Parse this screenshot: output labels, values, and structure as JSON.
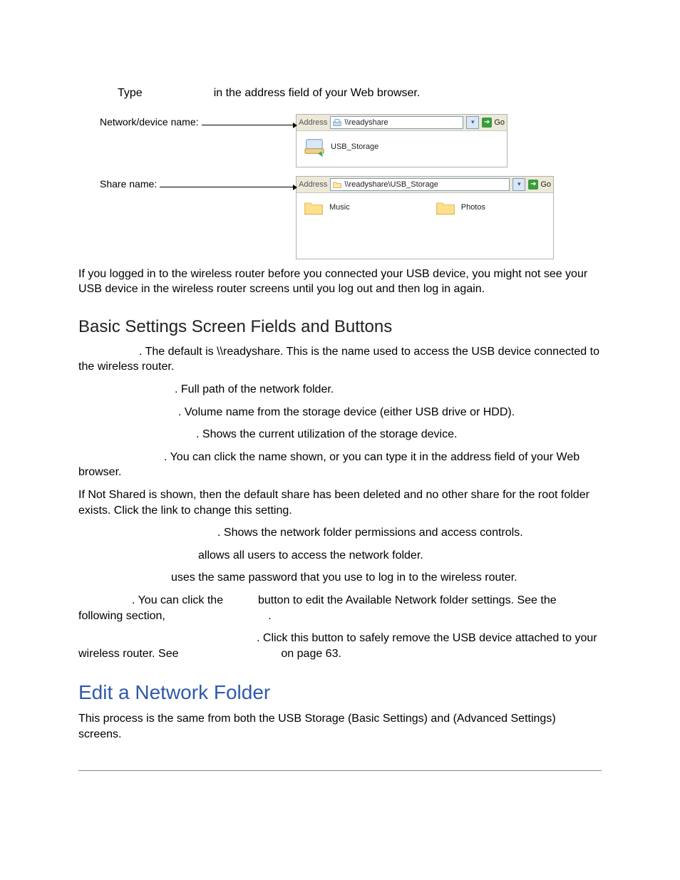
{
  "top": {
    "type_label": "Type",
    "type_rest": "in the address field of your Web browser."
  },
  "callouts": {
    "network_device": "Network/device name:",
    "share_name": "Share name:"
  },
  "explorer1": {
    "addr_label": "Address",
    "addr_value": "\\\\readyshare",
    "go": "Go",
    "item_label": "USB_Storage"
  },
  "explorer2": {
    "addr_label": "Address",
    "addr_value": "\\\\readyshare\\USB_Storage",
    "go": "Go",
    "item1": "Music",
    "item2": "Photos"
  },
  "body": {
    "p_login": "If you logged in to the wireless router before you connected your USB device, you might not see your USB device in the wireless router screens until you log out and then log in again.",
    "h_basic": "Basic Settings Screen Fields and Buttons",
    "p_netdev": ". The default is \\\\readyshare. This is the name used to access the USB device connected to the wireless router.",
    "p_folder": ". Full path of the network folder.",
    "p_volname": ". Volume name from the storage device (either USB drive or HDD).",
    "p_util": ". Shows the current utilization of the storage device.",
    "p_clickname": ". You can click the name shown, or you can type it in the address field of your Web browser.",
    "p_notshared": "If Not Shared is shown, then the default share has been deleted and no other share for the root folder exists. Click the link to change this setting.",
    "p_perm": ". Shows the network folder permissions and access controls.",
    "p_allow": "allows all users to access the network folder.",
    "p_pwd": "uses the same password that you use to log in to the wireless router.",
    "p_edit_a": ". You can click the ",
    "p_edit_b": " button to edit the Available Network folder settings. See the following section, ",
    "p_edit_c": ".",
    "p_safely_a": ". Click this button to safely remove the USB device attached to your wireless router. See ",
    "p_safely_b": " on page 63.",
    "h_edit": "Edit a Network Folder",
    "p_edit_process": "This process is the same from both the USB Storage (Basic Settings) and (Advanced Settings) screens."
  }
}
